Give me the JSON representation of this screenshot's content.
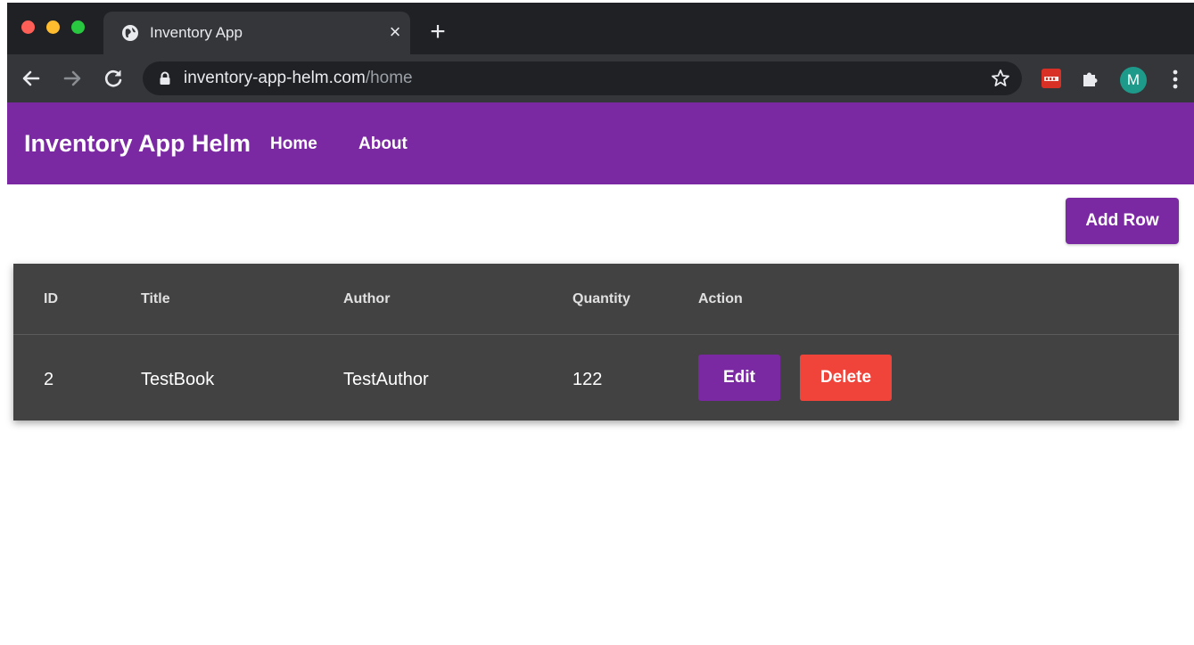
{
  "browser": {
    "tab_title": "Inventory App",
    "tab_close": "×",
    "new_tab": "+",
    "url_host": "inventory-app-helm.com",
    "url_path": "/home",
    "avatar_letter": "M"
  },
  "appbar": {
    "brand": "Inventory App Helm",
    "nav": [
      {
        "label": "Home"
      },
      {
        "label": "About"
      }
    ]
  },
  "toolbar": {
    "add_row_label": "Add Row"
  },
  "table": {
    "columns": [
      "ID",
      "Title",
      "Author",
      "Quantity",
      "Action"
    ],
    "rows": [
      {
        "id": "2",
        "title": "TestBook",
        "author": "TestAuthor",
        "quantity": "122",
        "edit_label": "Edit",
        "delete_label": "Delete"
      }
    ]
  },
  "colors": {
    "accent": "#7b29a3",
    "danger": "#f0443a",
    "table_bg": "#424242"
  }
}
